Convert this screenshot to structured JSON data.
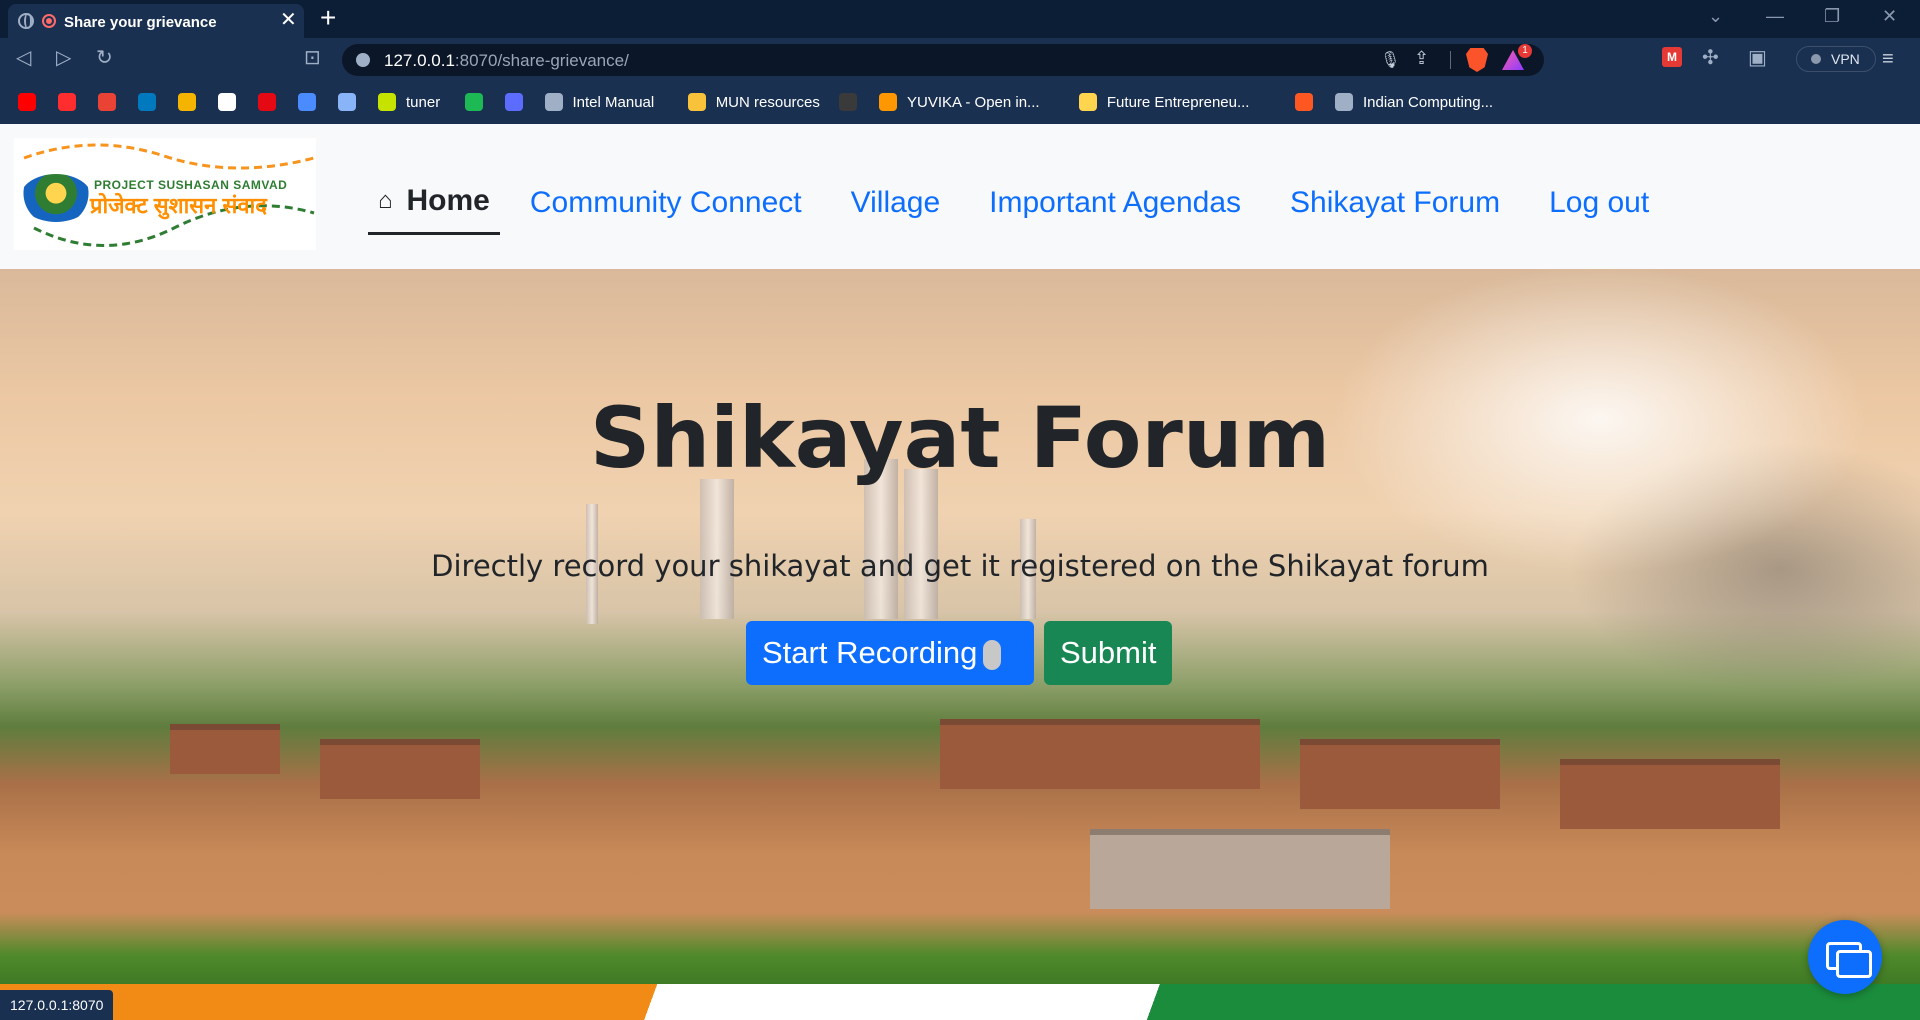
{
  "browser": {
    "tab": {
      "title": "Share your grievance",
      "close": "✕"
    },
    "new_tab": "+",
    "window_controls": {
      "down": "⌄",
      "minimize": "—",
      "restore": "❐",
      "close": "✕"
    },
    "nav_icons": {
      "back": "◁",
      "forward": "▷",
      "reload": "↻",
      "bookmark": "⊡"
    },
    "url": {
      "host": "127.0.0.1",
      "rest": ":8070/share-grievance/"
    },
    "shields_badge": "1",
    "vpn_label": "VPN",
    "menu": "≡",
    "bookmarks": [
      {
        "icon": "youtube-icon",
        "label": "",
        "color": "#ff0000"
      },
      {
        "icon": "youtube-music-icon",
        "label": "",
        "color": "#ff2d2d"
      },
      {
        "icon": "gmail-icon",
        "label": "",
        "color": "#ea4335"
      },
      {
        "icon": "trello-icon",
        "label": "",
        "color": "#0079bf"
      },
      {
        "icon": "classroom-icon",
        "label": "",
        "color": "#f4b400"
      },
      {
        "icon": "github-icon",
        "label": "",
        "color": "#ffffff"
      },
      {
        "icon": "netflix-icon",
        "label": "",
        "color": "#e50914"
      },
      {
        "icon": "graduation-cap-icon",
        "label": "",
        "color": "#4a8cff"
      },
      {
        "icon": "gemini-icon",
        "label": "",
        "color": "#8ab4f8"
      },
      {
        "icon": "shield-icon",
        "label": "tuner",
        "color": "#c6e300"
      },
      {
        "icon": "spotify-icon",
        "label": "",
        "color": "#1db954"
      },
      {
        "icon": "app-icon",
        "label": "",
        "color": "#5b6cff"
      },
      {
        "icon": "globe-icon",
        "label": "Intel Manual",
        "color": "#9fb0c6"
      },
      {
        "icon": "folder-icon",
        "label": "MUN resources",
        "color": "#f8c23a"
      },
      {
        "icon": "dots-icon",
        "label": "",
        "color": "#3a3a3a"
      },
      {
        "icon": "rocket-icon",
        "label": "YUVIKA - Open in...",
        "color": "#ff9800"
      },
      {
        "icon": "bird-icon",
        "label": "Future Entrepreneu...",
        "color": "#ffd54f"
      },
      {
        "icon": "power-icon",
        "label": "",
        "color": "#ff5722"
      },
      {
        "icon": "globe-icon",
        "label": "Indian Computing...",
        "color": "#9fb0c6"
      }
    ]
  },
  "site": {
    "logo": {
      "line1": "PROJECT SUSHASAN SAMVAD",
      "line2": "प्रोजेक्ट सुशासन संवाद"
    },
    "nav": {
      "home": "Home",
      "items": [
        "Community Connect",
        "Village",
        "Important Agendas",
        "Shikayat Forum",
        "Log out"
      ]
    },
    "hero": {
      "title": "Shikayat Forum",
      "subtitle": "Directly record your shikayat and get it registered on the Shikayat forum",
      "record_button": "Start Recording",
      "submit_button": "Submit"
    }
  },
  "status_bar": "127.0.0.1:8070",
  "colors": {
    "primary": "#0d6efd",
    "success": "#198754",
    "chrome": "#1a3050"
  }
}
